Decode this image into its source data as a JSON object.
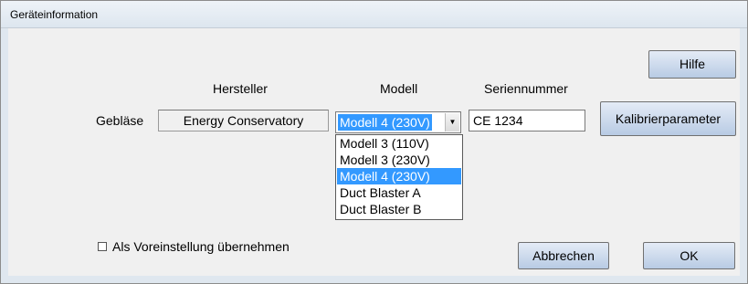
{
  "window": {
    "title": "Geräteinformation"
  },
  "headers": {
    "manufacturer": "Hersteller",
    "model": "Modell",
    "serial": "Seriennummer"
  },
  "row": {
    "label": "Gebläse",
    "manufacturer_value": "Energy Conservatory",
    "model_selected": "Modell 4 (230V)",
    "serial_value": "CE 1234"
  },
  "model_options": [
    "Modell 3 (110V)",
    "Modell 3 (230V)",
    "Modell 4 (230V)",
    "Duct Blaster A",
    "Duct Blaster B"
  ],
  "model_selected_index": 2,
  "buttons": {
    "help": "Hilfe",
    "calibration": "Kalibrierparameter",
    "cancel": "Abbrechen",
    "ok": "OK"
  },
  "default_checkbox": {
    "label": "Als Voreinstellung übernehmen",
    "checked": false
  },
  "colors": {
    "selection": "#3399ff",
    "button_top": "#e4ebf6",
    "button_bottom": "#b8cbe4"
  }
}
